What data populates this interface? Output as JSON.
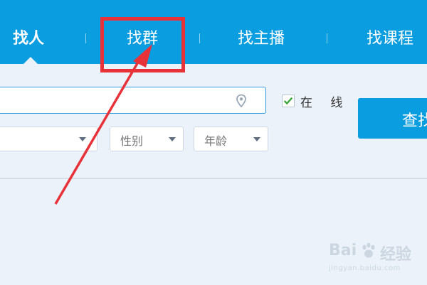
{
  "tabs": [
    {
      "label": "找人",
      "active": true
    },
    {
      "label": "找群",
      "active": false
    },
    {
      "label": "找主播",
      "active": false
    },
    {
      "label": "找课程",
      "active": false
    }
  ],
  "search": {
    "placeholder": "",
    "location_icon": "map-pin-icon"
  },
  "filters": {
    "online_label": "在 线",
    "online_checked": true,
    "dropdowns": [
      {
        "label": ""
      },
      {
        "label": "性别"
      },
      {
        "label": "年龄"
      }
    ]
  },
  "search_button": {
    "label": "查找"
  },
  "annotation": {
    "color": "#e8323a",
    "target": "找群"
  },
  "watermark": {
    "main": "Bai",
    "suffix": "经验",
    "sub": "jingyan.baidu.com"
  },
  "colors": {
    "accent": "#0a9de0",
    "background": "#ebf2fa",
    "annotation": "#e8323a",
    "check": "#3aa53a"
  }
}
